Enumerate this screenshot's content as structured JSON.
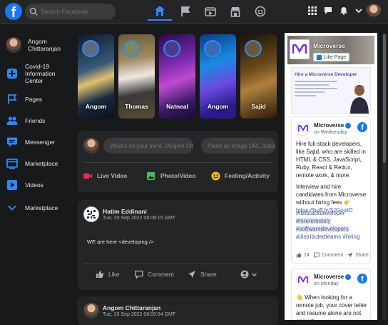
{
  "topbar": {
    "logo_letter": "f",
    "search_placeholder": "Search Facebook"
  },
  "sidebar": {
    "user_name": "Angom Chittaranjan",
    "items": [
      {
        "label": "Covid-19 Information Center",
        "icon": "plus-icon"
      },
      {
        "label": "Pages",
        "icon": "flag-icon"
      },
      {
        "label": "Friends",
        "icon": "people-icon"
      },
      {
        "label": "Messenger",
        "icon": "chat-icon"
      },
      {
        "label": "Marketplace",
        "icon": "store-icon"
      },
      {
        "label": "Videos",
        "icon": "video-icon"
      },
      {
        "label": "Marketplace",
        "icon": "chevron-down-icon"
      }
    ]
  },
  "stories": [
    {
      "name": "Angom"
    },
    {
      "name": "Thomas"
    },
    {
      "name": "Natneal"
    },
    {
      "name": "Angom"
    },
    {
      "name": "Sajid"
    }
  ],
  "composer": {
    "status_placeholder": "What's on your mind, /Angom Chitta",
    "image_placeholder": "Paste an image URL (optio",
    "actions": {
      "live": "Live Video",
      "photo": "Photo/Video",
      "feeling": "Feeling/Activity"
    }
  },
  "posts": [
    {
      "author": "Hatim Eddinani",
      "time": "Tue, 20 Sep 2022 08:08:15 GMT",
      "text": "WE are here <developing />",
      "like": "Like",
      "comment": "Comment",
      "share": "Share"
    },
    {
      "author": "Angom Chittaranjan",
      "time": "Tue, 20 Sep 2022 08:00:54 GMT"
    }
  ],
  "right": {
    "page_name": "Microverse",
    "like_page": "Like Page",
    "ad_title": "Hire a Microverse Developer",
    "card1": {
      "name": "Microverse",
      "sub": "on Wednesday",
      "p1": "Hire full-stack developers, like Sajid, who are skilled in HTML & CSS, JavaScript, Ruby, React & Redux, remote work, & more.",
      "p2": "Interview and hire candidates from Microverse without hiring fees 👉",
      "p2_link": "https://buff.ly/3JGooIO",
      "tag1": "#fullstackdeveloper",
      "tag2": "#hireremotely",
      "tag3": "#softwaredevelopers",
      "tag4": "#distributedteams",
      "tag5": "#hiring",
      "likes": "24",
      "comment": "Comment",
      "share": "Share"
    },
    "card2": {
      "name": "Microverse",
      "sub": "on Monday",
      "text": "👋 When looking for a remote job, your cover letter and resume alone are not enough."
    }
  }
}
